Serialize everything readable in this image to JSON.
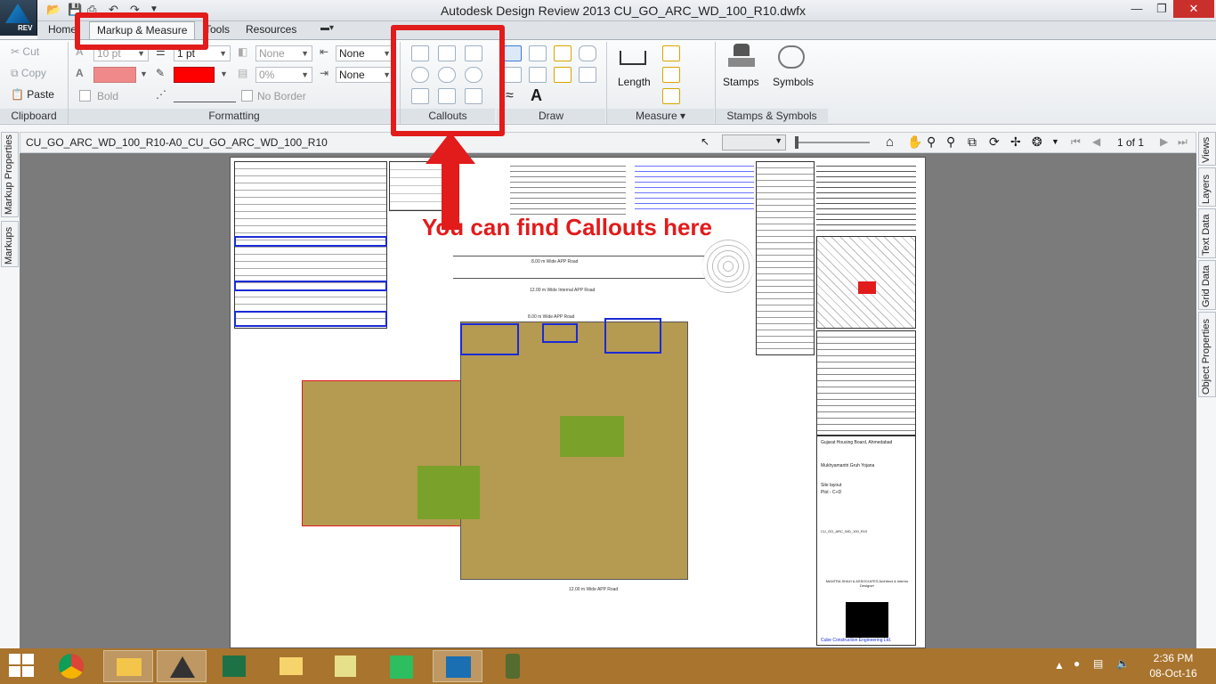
{
  "window": {
    "title": "Autodesk Design Review 2013    CU_GO_ARC_WD_100_R10.dwfx",
    "app_badge": "REV"
  },
  "ribbon_tabs": [
    "Home",
    "Markup & Measure",
    "Tools",
    "Resources"
  ],
  "clipboard": {
    "cut": "Cut",
    "copy": "Copy",
    "paste": "Paste",
    "title": "Clipboard"
  },
  "formatting": {
    "font_size": "10 pt",
    "line_weight": "1 pt",
    "fill_none": "None",
    "transparency": "0%",
    "line_start": "None",
    "line_end": "None",
    "bold": "Bold",
    "no_border": "No Border",
    "title": "Formatting"
  },
  "panels": {
    "callouts": "Callouts",
    "draw": "Draw",
    "measure": "Measure",
    "stamps_symbols": "Stamps & Symbols"
  },
  "measure": {
    "length": "Length"
  },
  "stamps": {
    "stamps": "Stamps",
    "symbols": "Symbols"
  },
  "docbar": {
    "doc_name": "CU_GO_ARC_WD_100_R10-A0_CU_GO_ARC_WD_100_R10",
    "page": "1 of 1"
  },
  "side_tabs_left": [
    "Markup Properties",
    "Markups"
  ],
  "side_tabs_right": [
    "Views",
    "Layers",
    "Text Data",
    "Grid Data",
    "Object Properties"
  ],
  "annotation": {
    "text": "You can find Callouts here"
  },
  "drawing": {
    "road_top_1": "8.00 m Wide APP Road",
    "road_top_2": "12.00 m Wide Internal APP Road",
    "road_top_3": "8.00 m Wide APP Road",
    "road_bottom": "12.00 m Wide APP Road",
    "client": "Gujarat Housing Board, Ahmedabad",
    "project": "Mukhyamantri Gruh Yojana",
    "sheet_title": "Site layout",
    "sheet_sub": "Plot - C+D",
    "drawing_no": "CU_GO_ARC_WD_100_R10",
    "architect": "MANTRA SHAH & ASSOCIATES Architect & Interior Designer",
    "contractor": "Cube Construction Engineering Ltd."
  },
  "taskbar": {
    "time": "2:36 PM",
    "date": "08-Oct-16"
  },
  "colors": {
    "highlight": "#e21b1b",
    "taskbar": "#a8742e",
    "site_fill": "#b59a52",
    "green": "#7aa22a"
  }
}
